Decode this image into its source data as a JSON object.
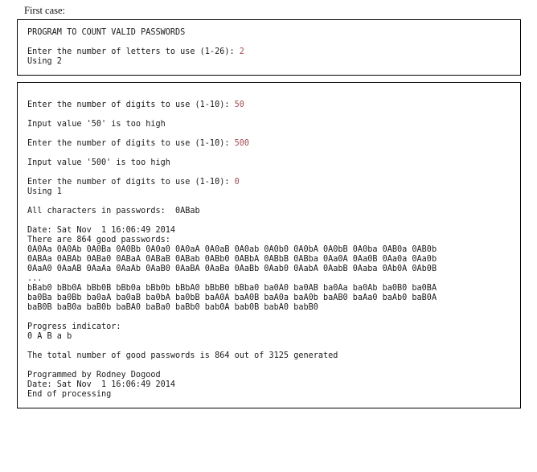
{
  "caption": "First case:",
  "box1": {
    "lines": [
      {
        "text": "PROGRAM TO COUNT VALID PASSWORDS"
      },
      {
        "text": ""
      },
      {
        "text": "Enter the number of letters to use (1-26): ",
        "input": "2"
      },
      {
        "text": "Using 2"
      }
    ]
  },
  "box2": {
    "lines": [
      {
        "text": ""
      },
      {
        "text": "Enter the number of digits to use (1-10): ",
        "input": "50"
      },
      {
        "text": ""
      },
      {
        "text": "Input value '50' is too high"
      },
      {
        "text": ""
      },
      {
        "text": "Enter the number of digits to use (1-10): ",
        "input": "500"
      },
      {
        "text": ""
      },
      {
        "text": "Input value '500' is too high"
      },
      {
        "text": ""
      },
      {
        "text": "Enter the number of digits to use (1-10): ",
        "input": "0"
      },
      {
        "text": "Using 1"
      },
      {
        "text": ""
      },
      {
        "text": "All characters in passwords:  0ABab"
      },
      {
        "text": ""
      },
      {
        "text": "Date: Sat Nov  1 16:06:49 2014"
      },
      {
        "text": "There are 864 good passwords:"
      },
      {
        "text": "0A0Aa 0A0Ab 0A0Ba 0A0Bb 0A0a0 0A0aA 0A0aB 0A0ab 0A0b0 0A0bA 0A0bB 0A0ba 0AB0a 0AB0b"
      },
      {
        "text": "0ABAa 0ABAb 0ABa0 0ABaA 0ABaB 0ABab 0ABb0 0ABbA 0ABbB 0ABba 0Aa0A 0Aa0B 0Aa0a 0Aa0b"
      },
      {
        "text": "0AaA0 0AaAB 0AaAa 0AaAb 0AaB0 0AaBA 0AaBa 0AaBb 0Aab0 0AabA 0AabB 0Aaba 0Ab0A 0Ab0B"
      },
      {
        "text": "..."
      },
      {
        "text": "bBab0 bBb0A bBb0B bBb0a bBb0b bBbA0 bBbB0 bBba0 ba0A0 ba0AB ba0Aa ba0Ab ba0B0 ba0BA"
      },
      {
        "text": "ba0Ba ba0Bb ba0aA ba0aB ba0bA ba0bB baA0A baA0B baA0a baA0b baAB0 baAa0 baAb0 baB0A"
      },
      {
        "text": "baB0B baB0a baB0b baBA0 baBa0 baBb0 bab0A bab0B babA0 babB0"
      },
      {
        "text": ""
      },
      {
        "text": "Progress indicator:"
      },
      {
        "text": "0 A B a b"
      },
      {
        "text": ""
      },
      {
        "text": "The total number of good passwords is 864 out of 3125 generated"
      },
      {
        "text": ""
      },
      {
        "text": "Programmed by Rodney Dogood"
      },
      {
        "text": "Date: Sat Nov  1 16:06:49 2014"
      },
      {
        "text": "End of processing"
      }
    ]
  },
  "colors": {
    "input_value": "#a04a52",
    "border": "#000000",
    "text": "#1a1a1a"
  }
}
